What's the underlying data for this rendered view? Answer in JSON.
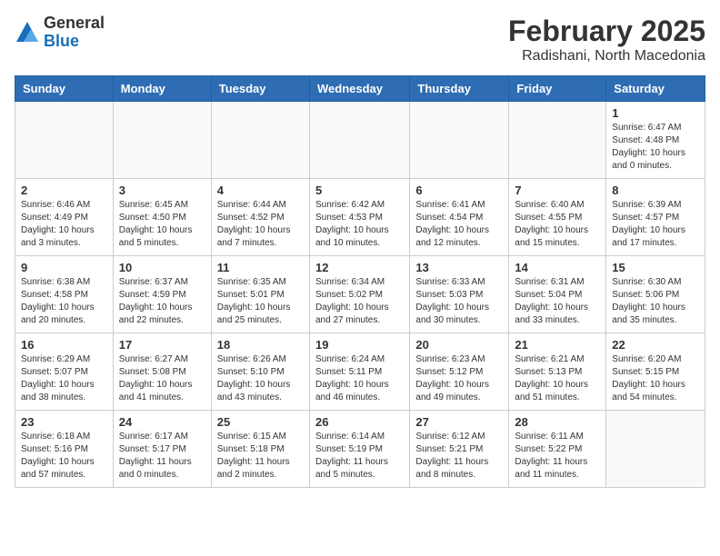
{
  "header": {
    "logo": {
      "general": "General",
      "blue": "Blue"
    },
    "month_year": "February 2025",
    "location": "Radishani, North Macedonia"
  },
  "calendar": {
    "weekdays": [
      "Sunday",
      "Monday",
      "Tuesday",
      "Wednesday",
      "Thursday",
      "Friday",
      "Saturday"
    ],
    "weeks": [
      [
        {
          "day": "",
          "info": ""
        },
        {
          "day": "",
          "info": ""
        },
        {
          "day": "",
          "info": ""
        },
        {
          "day": "",
          "info": ""
        },
        {
          "day": "",
          "info": ""
        },
        {
          "day": "",
          "info": ""
        },
        {
          "day": "1",
          "info": "Sunrise: 6:47 AM\nSunset: 4:48 PM\nDaylight: 10 hours and 0 minutes."
        }
      ],
      [
        {
          "day": "2",
          "info": "Sunrise: 6:46 AM\nSunset: 4:49 PM\nDaylight: 10 hours and 3 minutes."
        },
        {
          "day": "3",
          "info": "Sunrise: 6:45 AM\nSunset: 4:50 PM\nDaylight: 10 hours and 5 minutes."
        },
        {
          "day": "4",
          "info": "Sunrise: 6:44 AM\nSunset: 4:52 PM\nDaylight: 10 hours and 7 minutes."
        },
        {
          "day": "5",
          "info": "Sunrise: 6:42 AM\nSunset: 4:53 PM\nDaylight: 10 hours and 10 minutes."
        },
        {
          "day": "6",
          "info": "Sunrise: 6:41 AM\nSunset: 4:54 PM\nDaylight: 10 hours and 12 minutes."
        },
        {
          "day": "7",
          "info": "Sunrise: 6:40 AM\nSunset: 4:55 PM\nDaylight: 10 hours and 15 minutes."
        },
        {
          "day": "8",
          "info": "Sunrise: 6:39 AM\nSunset: 4:57 PM\nDaylight: 10 hours and 17 minutes."
        }
      ],
      [
        {
          "day": "9",
          "info": "Sunrise: 6:38 AM\nSunset: 4:58 PM\nDaylight: 10 hours and 20 minutes."
        },
        {
          "day": "10",
          "info": "Sunrise: 6:37 AM\nSunset: 4:59 PM\nDaylight: 10 hours and 22 minutes."
        },
        {
          "day": "11",
          "info": "Sunrise: 6:35 AM\nSunset: 5:01 PM\nDaylight: 10 hours and 25 minutes."
        },
        {
          "day": "12",
          "info": "Sunrise: 6:34 AM\nSunset: 5:02 PM\nDaylight: 10 hours and 27 minutes."
        },
        {
          "day": "13",
          "info": "Sunrise: 6:33 AM\nSunset: 5:03 PM\nDaylight: 10 hours and 30 minutes."
        },
        {
          "day": "14",
          "info": "Sunrise: 6:31 AM\nSunset: 5:04 PM\nDaylight: 10 hours and 33 minutes."
        },
        {
          "day": "15",
          "info": "Sunrise: 6:30 AM\nSunset: 5:06 PM\nDaylight: 10 hours and 35 minutes."
        }
      ],
      [
        {
          "day": "16",
          "info": "Sunrise: 6:29 AM\nSunset: 5:07 PM\nDaylight: 10 hours and 38 minutes."
        },
        {
          "day": "17",
          "info": "Sunrise: 6:27 AM\nSunset: 5:08 PM\nDaylight: 10 hours and 41 minutes."
        },
        {
          "day": "18",
          "info": "Sunrise: 6:26 AM\nSunset: 5:10 PM\nDaylight: 10 hours and 43 minutes."
        },
        {
          "day": "19",
          "info": "Sunrise: 6:24 AM\nSunset: 5:11 PM\nDaylight: 10 hours and 46 minutes."
        },
        {
          "day": "20",
          "info": "Sunrise: 6:23 AM\nSunset: 5:12 PM\nDaylight: 10 hours and 49 minutes."
        },
        {
          "day": "21",
          "info": "Sunrise: 6:21 AM\nSunset: 5:13 PM\nDaylight: 10 hours and 51 minutes."
        },
        {
          "day": "22",
          "info": "Sunrise: 6:20 AM\nSunset: 5:15 PM\nDaylight: 10 hours and 54 minutes."
        }
      ],
      [
        {
          "day": "23",
          "info": "Sunrise: 6:18 AM\nSunset: 5:16 PM\nDaylight: 10 hours and 57 minutes."
        },
        {
          "day": "24",
          "info": "Sunrise: 6:17 AM\nSunset: 5:17 PM\nDaylight: 11 hours and 0 minutes."
        },
        {
          "day": "25",
          "info": "Sunrise: 6:15 AM\nSunset: 5:18 PM\nDaylight: 11 hours and 2 minutes."
        },
        {
          "day": "26",
          "info": "Sunrise: 6:14 AM\nSunset: 5:19 PM\nDaylight: 11 hours and 5 minutes."
        },
        {
          "day": "27",
          "info": "Sunrise: 6:12 AM\nSunset: 5:21 PM\nDaylight: 11 hours and 8 minutes."
        },
        {
          "day": "28",
          "info": "Sunrise: 6:11 AM\nSunset: 5:22 PM\nDaylight: 11 hours and 11 minutes."
        },
        {
          "day": "",
          "info": ""
        }
      ]
    ]
  }
}
